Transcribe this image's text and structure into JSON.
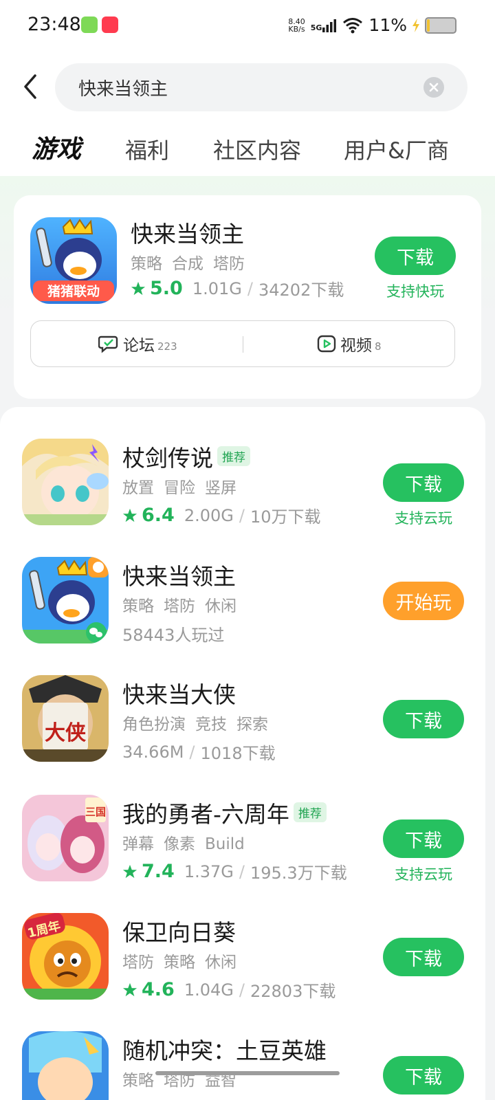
{
  "status_bar": {
    "time": "23:48",
    "net_speed_value": "8.40",
    "net_speed_unit": "KB/s",
    "network": "5G",
    "battery": "11%"
  },
  "search": {
    "query": "快来当领主"
  },
  "tabs": [
    "游戏",
    "福利",
    "社区内容",
    "用户&厂商"
  ],
  "featured": {
    "title": "快来当领主",
    "tags": [
      "策略",
      "合成",
      "塔防"
    ],
    "rating": "5.0",
    "size": "1.01G",
    "downloads": "34202下载",
    "button": "下载",
    "sub": "支持快玩",
    "icon_banner": "猪猪联动",
    "forum_label": "论坛",
    "forum_count": "223",
    "video_label": "视频",
    "video_count": "8"
  },
  "games": [
    {
      "title": "杖剑传说",
      "badge": "推荐",
      "tags": [
        "放置",
        "冒险",
        "竖屏"
      ],
      "rating": "6.4",
      "size": "2.00G",
      "downloads": "10万下载",
      "button": "下载",
      "sub": "支持云玩"
    },
    {
      "title": "快来当领主",
      "badge": "",
      "tags": [
        "策略",
        "塔防",
        "休闲"
      ],
      "rating": "",
      "size": "",
      "downloads": "58443人玩过",
      "button": "开始玩",
      "sub": ""
    },
    {
      "title": "快来当大侠",
      "badge": "",
      "tags": [
        "角色扮演",
        "竞技",
        "探索"
      ],
      "rating": "",
      "size": "34.66M",
      "downloads": "1018下载",
      "button": "下载",
      "sub": ""
    },
    {
      "title": "我的勇者-六周年",
      "badge": "推荐",
      "tags": [
        "弹幕",
        "像素",
        "Build"
      ],
      "rating": "7.4",
      "size": "1.37G",
      "downloads": "195.3万下载",
      "button": "下载",
      "sub": "支持云玩"
    },
    {
      "title": "保卫向日葵",
      "badge": "",
      "tags": [
        "塔防",
        "策略",
        "休闲"
      ],
      "rating": "4.6",
      "size": "1.04G",
      "downloads": "22803下载",
      "button": "下载",
      "sub": ""
    },
    {
      "title": "随机冲突：土豆英雄",
      "badge": "",
      "tags": [
        "策略",
        "塔防",
        "益智"
      ],
      "rating": "",
      "size": "",
      "downloads": "",
      "button": "下载",
      "sub": ""
    }
  ],
  "icon_texts": {
    "hero_char": "大侠",
    "anniv": "1周年",
    "sanguo": "三国"
  },
  "colors": {
    "accent_green": "#26c160",
    "rating_green": "#22b35a",
    "orange": "#ffa02b"
  }
}
